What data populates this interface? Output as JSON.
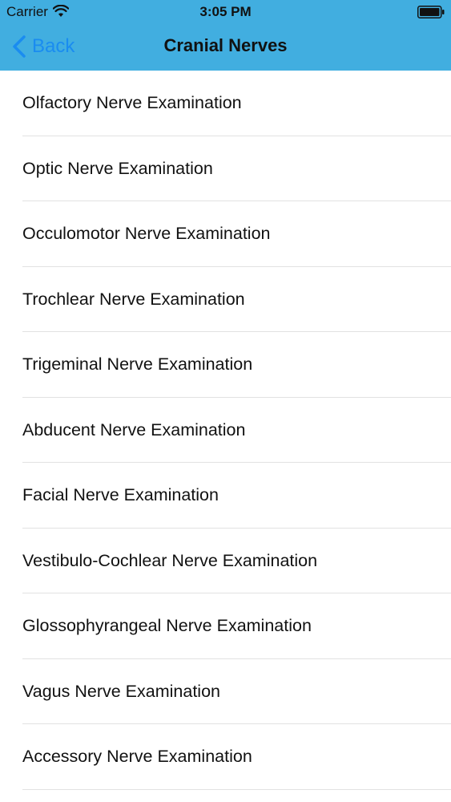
{
  "status_bar": {
    "carrier": "Carrier",
    "time": "3:05 PM"
  },
  "nav": {
    "back_label": "Back",
    "title": "Cranial Nerves",
    "bar_color": "#41aee0",
    "back_color": "#1a8cf0"
  },
  "items": [
    {
      "label": "Olfactory Nerve Examination"
    },
    {
      "label": "Optic Nerve Examination"
    },
    {
      "label": "Occulomotor Nerve Examination"
    },
    {
      "label": "Trochlear Nerve Examination"
    },
    {
      "label": "Trigeminal Nerve Examination"
    },
    {
      "label": "Abducent Nerve Examination"
    },
    {
      "label": "Facial Nerve Examination"
    },
    {
      "label": "Vestibulo-Cochlear Nerve Examination"
    },
    {
      "label": "Glossophyrangeal Nerve Examination"
    },
    {
      "label": "Vagus Nerve Examination"
    },
    {
      "label": "Accessory Nerve Examination"
    }
  ]
}
